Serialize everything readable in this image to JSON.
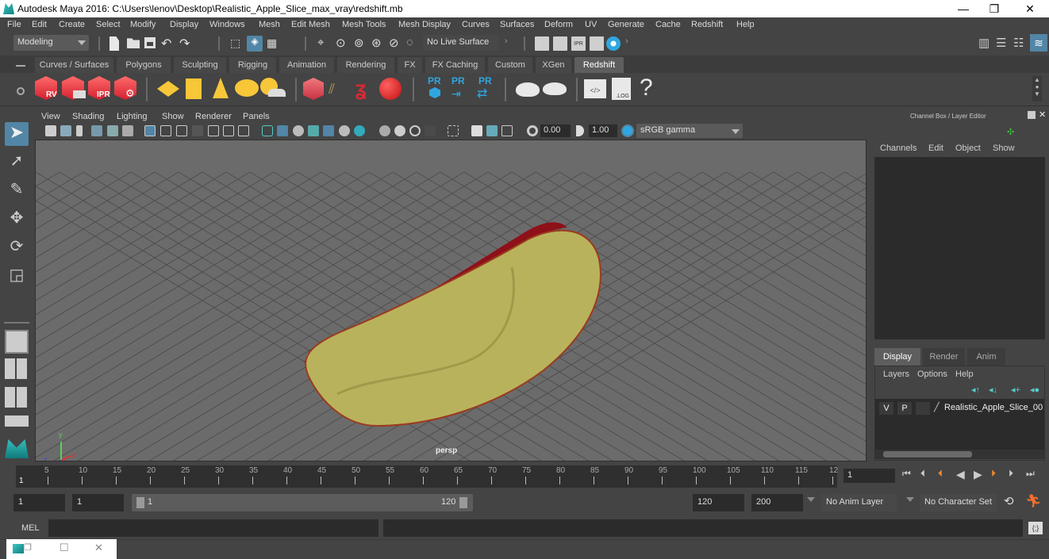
{
  "window": {
    "title": "Autodesk Maya 2016: C:\\Users\\lenov\\Desktop\\Realistic_Apple_Slice_max_vray\\redshift.mb",
    "minimize": "—",
    "restore": "❐",
    "close": "✕"
  },
  "menubar": [
    "File",
    "Edit",
    "Create",
    "Select",
    "Modify",
    "Display",
    "Windows",
    "Mesh",
    "Edit Mesh",
    "Mesh Tools",
    "Mesh Display",
    "Curves",
    "Surfaces",
    "Deform",
    "UV",
    "Generate",
    "Cache",
    "Redshift",
    "Help"
  ],
  "statusline": {
    "menuset": "Modeling",
    "live_surface": "No Live Surface"
  },
  "shelf": {
    "tabs": [
      "Curves / Surfaces",
      "Polygons",
      "Sculpting",
      "Rigging",
      "Animation",
      "Rendering",
      "FX",
      "FX Caching",
      "Custom",
      "XGen",
      "Redshift"
    ],
    "active_tab": "Redshift",
    "cube_labels": [
      "RV",
      "",
      "IPR",
      ""
    ],
    "pr_labels": [
      "PR",
      "PR",
      "PR"
    ],
    "log_label": ".LOG",
    "help_label": "?"
  },
  "panel": {
    "menus": [
      "View",
      "Shading",
      "Lighting",
      "Show",
      "Renderer",
      "Panels"
    ],
    "exposure": "0.00",
    "gamma": "1.00",
    "colorspace": "sRGB gamma",
    "camera_label": "persp",
    "axis": {
      "x": "x",
      "y": "y",
      "z": "z"
    }
  },
  "channelbox": {
    "title": "Channel Box / Layer Editor",
    "menus": [
      "Channels",
      "Edit",
      "Object",
      "Show"
    ],
    "layer_tabs": [
      "Display",
      "Render",
      "Anim"
    ],
    "active_layer_tab": "Display",
    "layer_menus": [
      "Layers",
      "Options",
      "Help"
    ],
    "layers": [
      {
        "v": "V",
        "p": "P",
        "name": "Realistic_Apple_Slice_00"
      }
    ]
  },
  "timeslider": {
    "ticks": [
      "5",
      "10",
      "15",
      "20",
      "25",
      "30",
      "35",
      "40",
      "45",
      "50",
      "55",
      "60",
      "65",
      "70",
      "75",
      "80",
      "85",
      "90",
      "95",
      "100",
      "105",
      "110",
      "115",
      "12"
    ],
    "current_frame_label": "1",
    "current_frame_field": "1"
  },
  "rangeslider": {
    "start_time": "1",
    "playback_start": "1",
    "range_start": "1",
    "range_end": "120",
    "playback_end": "120",
    "end_time": "200",
    "anim_layer": "No Anim Layer",
    "character_set": "No Character Set"
  },
  "cmdline": {
    "language": "MEL",
    "input": "",
    "result": ""
  },
  "colors": {
    "accent_blue": "#5285a6",
    "redshift_red": "#e8303e",
    "shelf_yellow": "#f7c739",
    "pr_blue": "#2fa6e0"
  }
}
